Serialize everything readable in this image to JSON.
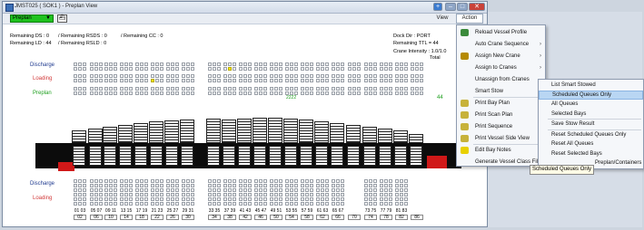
{
  "window": {
    "title": "JMST025 ( SOK1 ) - Preplan View",
    "buttons": {
      "plus": "+",
      "min": "–",
      "max": "□",
      "close": "✕"
    }
  },
  "toolbar": {
    "combo_value": "Preplan",
    "view_label": "View",
    "action_label": "Action"
  },
  "stats": {
    "remaining_ds": "Remaining DS : 0",
    "remaining_rsds": "/ Remaining RSDS : 0",
    "remaining_cc": "/ Remaining CC : 0",
    "remaining_ld": "Remaining LD : 44",
    "remaining_rsld": "/ Remaining RSLD : 0",
    "dock_dir": "Dock Dir : PORT",
    "remaining_ttl": "Remaining TTL = 44",
    "crane_intensity": "Crane Intensity : 1.0/1.0",
    "total": "Total"
  },
  "row_labels": {
    "discharge_top": "Discharge",
    "loading_top": "Loading",
    "preplan": "Preplan",
    "discharge_bottom": "Discharge",
    "loading_bottom": "Loading"
  },
  "preplan_total": "44",
  "preplan_marker": "2222",
  "bays": [
    {
      "pair": "01 03",
      "no": "02"
    },
    {
      "pair": "05 07",
      "no": "06"
    },
    {
      "pair": "09 11",
      "no": "10"
    },
    {
      "pair": "13 15",
      "no": "14"
    },
    {
      "pair": "17 19",
      "no": "18"
    },
    {
      "pair": "21 23",
      "no": "22"
    },
    {
      "pair": "25 27",
      "no": "26"
    },
    {
      "pair": "29 31",
      "no": "30"
    },
    {
      "pair": "33 35",
      "no": "34"
    },
    {
      "pair": "37 39",
      "no": "38"
    },
    {
      "pair": "41 43",
      "no": "42"
    },
    {
      "pair": "45 47",
      "no": "46"
    },
    {
      "pair": "49 51",
      "no": "50"
    },
    {
      "pair": "53 55",
      "no": "54"
    },
    {
      "pair": "57 59",
      "no": "58"
    },
    {
      "pair": "61 63",
      "no": "62"
    },
    {
      "pair": "65 67",
      "no": "66"
    },
    {
      "pair": "",
      "no": "70"
    },
    {
      "pair": "73 75",
      "no": "74"
    },
    {
      "pair": "77 79",
      "no": "78"
    },
    {
      "pair": "81 83",
      "no": "82"
    },
    {
      "pair": "",
      "no": "86"
    }
  ],
  "action_menu": {
    "items": [
      {
        "label": "Reload Vessel Profile",
        "icon": "reload-icon",
        "submenu": false
      },
      {
        "label": "Auto Crane Sequence",
        "icon": "",
        "submenu": true
      },
      {
        "label": "Assign New Crane",
        "icon": "crane-icon",
        "submenu": true
      },
      {
        "label": "Assign to Cranes",
        "icon": "",
        "submenu": true
      },
      {
        "label": "Unassign from Cranes",
        "icon": "",
        "submenu": false
      },
      {
        "label": "Smart Stow",
        "icon": "",
        "submenu": true
      },
      {
        "label": "Print Bay Plan",
        "icon": "printer-icon",
        "submenu": false
      },
      {
        "label": "Print Scan Plan",
        "icon": "printer-icon",
        "submenu": false
      },
      {
        "label": "Print Sequence",
        "icon": "printer-icon",
        "submenu": false
      },
      {
        "label": "Print Vessel Side View",
        "icon": "printer-icon",
        "submenu": false
      },
      {
        "label": "Edit Bay Notes",
        "icon": "note-icon",
        "submenu": false
      },
      {
        "label": "Generate Vessel Class File",
        "icon": "",
        "submenu": false
      }
    ]
  },
  "smart_stow_menu": {
    "items": [
      "List Smart Stowed",
      "Scheduled Queues Only",
      "All Queues",
      "Selected Bays",
      "Save Stow Result",
      "Reset Scheduled Queues Only",
      "Reset All Queues",
      "Reset Selected Bays",
      "Preplan/Containers"
    ],
    "highlighted": "Scheduled Queues Only"
  },
  "tooltip": "Scheduled Queues Only",
  "colors": {
    "combo_bg": "#1fc21f",
    "discharge": "#1f3a8f",
    "loading": "#d23b3b",
    "preplan": "#1fa01f",
    "highlight": "#b9d6f3"
  }
}
